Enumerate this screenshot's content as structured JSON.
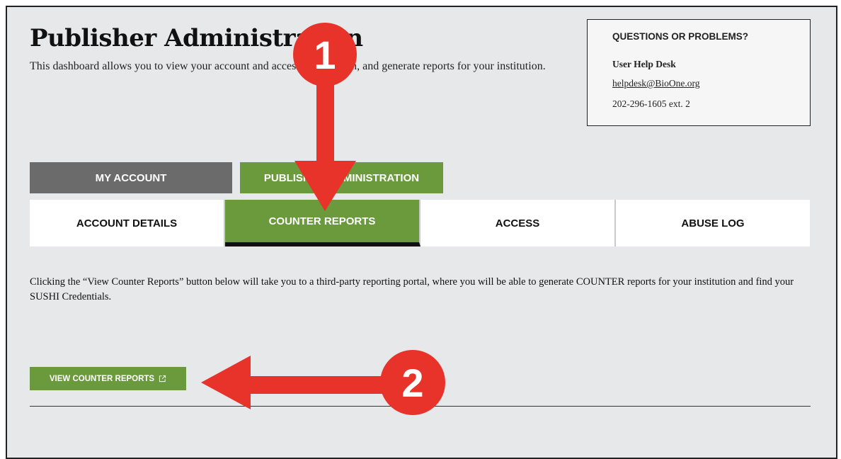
{
  "page": {
    "title": "Publisher Administration",
    "description": "This dashboard allows you to view your account and access information, and generate reports for your institution."
  },
  "help": {
    "heading": "QUESTIONS OR PROBLEMS?",
    "name": "User Help Desk",
    "email": "helpdesk@BioOne.org",
    "phone": "202-296-1605 ext. 2"
  },
  "tabs": [
    {
      "label": "MY ACCOUNT",
      "active": false
    },
    {
      "label": "PUBLISHER ADMINISTRATION",
      "active": true
    }
  ],
  "subtabs": [
    {
      "label": "ACCOUNT DETAILS",
      "active": false
    },
    {
      "label": "COUNTER REPORTS",
      "active": true
    },
    {
      "label": "ACCESS",
      "active": false
    },
    {
      "label": "ABUSE LOG",
      "active": false
    }
  ],
  "content": {
    "info": "Clicking the “View Counter Reports” button below will take you to a third-party reporting portal, where you will be able to generate COUNTER reports for your institution and find your SUSHI Credentials.",
    "button_label": "VIEW COUNTER REPORTS",
    "button_icon": "external-link-icon"
  },
  "annotations": [
    {
      "number": "1",
      "color": "#e8332a"
    },
    {
      "number": "2",
      "color": "#e8332a"
    }
  ],
  "colors": {
    "accent_green": "#6a9a3b",
    "tab_gray": "#6b6b6b",
    "background": "#e7e8ea"
  }
}
